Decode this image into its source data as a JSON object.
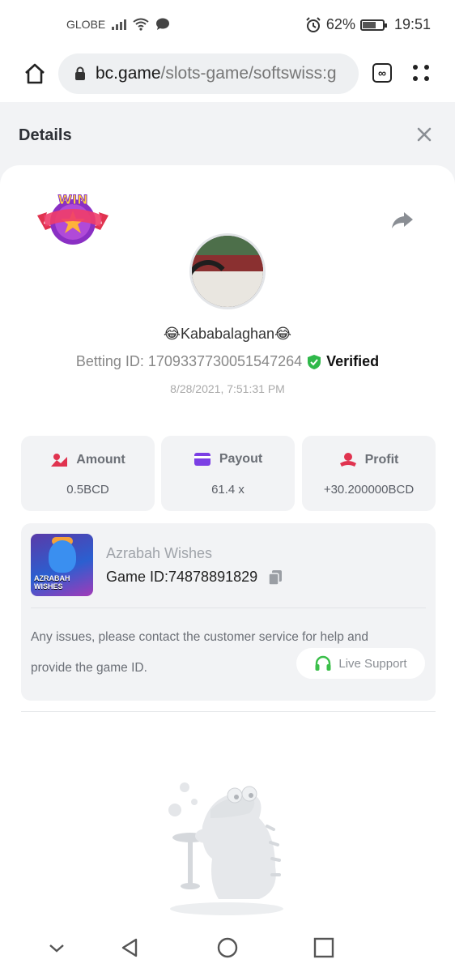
{
  "status_bar": {
    "carrier": "GLOBE",
    "battery_percent": "62%",
    "battery_level": 0.62,
    "time": "19:51",
    "icons": [
      "signal-icon",
      "wifi-icon",
      "chat-bubble-icon",
      "alarm-icon",
      "battery-icon"
    ]
  },
  "browser": {
    "url_host": "bc.game",
    "url_path": "/slots-game/softswiss:g",
    "tab_button_label": "∞"
  },
  "header": {
    "title": "Details"
  },
  "bet": {
    "username": "😂Kababalaghan😂",
    "betting_id_label": "Betting ID: 1709337730051547264",
    "verified_label": "Verified",
    "timestamp": "8/28/2021, 7:51:31 PM",
    "badge_text": "WIN"
  },
  "stats": [
    {
      "label": "Amount",
      "value": "0.5BCD",
      "icon": "amount-icon",
      "color": "#e0334f"
    },
    {
      "label": "Payout",
      "value": "61.4 x",
      "icon": "payout-icon",
      "color": "#7b3fe4"
    },
    {
      "label": "Profit",
      "value": "+30.200000BCD",
      "icon": "profit-icon",
      "color": "#e0334f"
    }
  ],
  "game": {
    "name": "Azrabah Wishes",
    "id_label": "Game ID:74878891829",
    "thumb_text": "AZRABAH WISHES",
    "issue_text": "Any issues, please contact the customer service for help and provide the game ID.",
    "issue_line1": "Any issues, please contact the customer service for help and",
    "issue_line2": "provide the game ID.",
    "live_support_label": "Live Support"
  },
  "colors": {
    "accent_green": "#3bbf4a",
    "verified_green": "#2fb84a",
    "page_bg": "#f2f3f5"
  }
}
